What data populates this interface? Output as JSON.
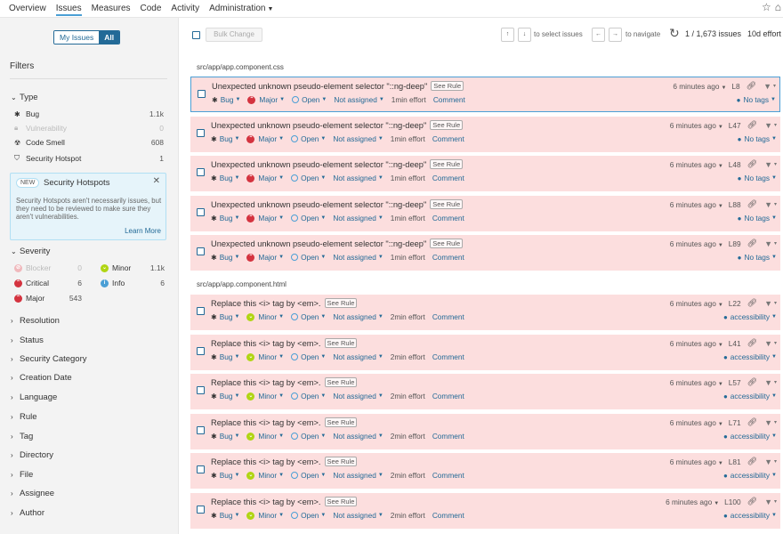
{
  "nav": {
    "items": [
      {
        "label": "Overview"
      },
      {
        "label": "Issues"
      },
      {
        "label": "Measures"
      },
      {
        "label": "Code"
      },
      {
        "label": "Activity"
      },
      {
        "label": "Administration"
      }
    ],
    "icons": [
      "star-icon",
      "home-icon"
    ]
  },
  "sidebar": {
    "toggle": {
      "my_issues": "My Issues",
      "all": "All"
    },
    "filters_title": "Filters",
    "type": {
      "label": "Type",
      "items": [
        {
          "label": "Bug",
          "count": "1.1k",
          "icon": "bug-icon"
        },
        {
          "label": "Vulnerability",
          "count": "0",
          "icon": "lock-icon"
        },
        {
          "label": "Code Smell",
          "count": "608",
          "icon": "code-smell-icon"
        },
        {
          "label": "Security Hotspot",
          "count": "1",
          "icon": "hotspot-icon"
        }
      ]
    },
    "hotspot_box": {
      "badge": "NEW",
      "title": "Security Hotspots",
      "text": "Security Hotspots aren't necessarily issues, but they need to be reviewed to make sure they aren't vulnerabilities.",
      "link": "Learn More"
    },
    "severity": {
      "label": "Severity",
      "items": [
        {
          "label": "Blocker",
          "count": "0",
          "color": "#d4333f"
        },
        {
          "label": "Minor",
          "count": "1.1k",
          "color": "#b0d513"
        },
        {
          "label": "Critical",
          "count": "6",
          "color": "#d4333f"
        },
        {
          "label": "Info",
          "count": "6",
          "color": "#4b9fd5"
        },
        {
          "label": "Major",
          "count": "543",
          "color": "#d4333f"
        }
      ]
    },
    "facets": [
      {
        "label": "Resolution"
      },
      {
        "label": "Status"
      },
      {
        "label": "Security Category"
      },
      {
        "label": "Creation Date"
      },
      {
        "label": "Language"
      },
      {
        "label": "Rule"
      },
      {
        "label": "Tag"
      },
      {
        "label": "Directory"
      },
      {
        "label": "File"
      },
      {
        "label": "Assignee"
      },
      {
        "label": "Author"
      }
    ]
  },
  "toolbar": {
    "bulk_change": "Bulk Change",
    "up_arrow": "↑",
    "down_arrow": "↓",
    "select_hint": "to select issues",
    "left_arrow": "←",
    "right_arrow": "→",
    "navigate_hint": "to navigate",
    "issue_count": "1 / 1,673 issues",
    "effort": "10d effort"
  },
  "groups": [
    {
      "file": "src/app/app.component.css",
      "issues": [
        {
          "message": "Unexpected unknown pseudo-element selector \"::ng-deep\"",
          "see_rule": "See Rule",
          "type": "Bug",
          "severity": "Major",
          "status": "Open",
          "assignee": "Not assigned",
          "effort": "1min effort",
          "comment": "Comment",
          "time": "6 minutes ago",
          "line": "L8",
          "tags": "No tags"
        },
        {
          "message": "Unexpected unknown pseudo-element selector \"::ng-deep\"",
          "see_rule": "See Rule",
          "type": "Bug",
          "severity": "Major",
          "status": "Open",
          "assignee": "Not assigned",
          "effort": "1min effort",
          "comment": "Comment",
          "time": "6 minutes ago",
          "line": "L47",
          "tags": "No tags"
        },
        {
          "message": "Unexpected unknown pseudo-element selector \"::ng-deep\"",
          "see_rule": "See Rule",
          "type": "Bug",
          "severity": "Major",
          "status": "Open",
          "assignee": "Not assigned",
          "effort": "1min effort",
          "comment": "Comment",
          "time": "6 minutes ago",
          "line": "L48",
          "tags": "No tags"
        },
        {
          "message": "Unexpected unknown pseudo-element selector \"::ng-deep\"",
          "see_rule": "See Rule",
          "type": "Bug",
          "severity": "Major",
          "status": "Open",
          "assignee": "Not assigned",
          "effort": "1min effort",
          "comment": "Comment",
          "time": "6 minutes ago",
          "line": "L88",
          "tags": "No tags"
        },
        {
          "message": "Unexpected unknown pseudo-element selector \"::ng-deep\"",
          "see_rule": "See Rule",
          "type": "Bug",
          "severity": "Major",
          "status": "Open",
          "assignee": "Not assigned",
          "effort": "1min effort",
          "comment": "Comment",
          "time": "6 minutes ago",
          "line": "L89",
          "tags": "No tags"
        }
      ]
    },
    {
      "file": "src/app/app.component.html",
      "issues": [
        {
          "message": "Replace this <i> tag by <em>.",
          "see_rule": "See Rule",
          "type": "Bug",
          "severity": "Minor",
          "status": "Open",
          "assignee": "Not assigned",
          "effort": "2min effort",
          "comment": "Comment",
          "time": "6 minutes ago",
          "line": "L22",
          "tags": "accessibility"
        },
        {
          "message": "Replace this <i> tag by <em>.",
          "see_rule": "See Rule",
          "type": "Bug",
          "severity": "Minor",
          "status": "Open",
          "assignee": "Not assigned",
          "effort": "2min effort",
          "comment": "Comment",
          "time": "6 minutes ago",
          "line": "L41",
          "tags": "accessibility"
        },
        {
          "message": "Replace this <i> tag by <em>.",
          "see_rule": "See Rule",
          "type": "Bug",
          "severity": "Minor",
          "status": "Open",
          "assignee": "Not assigned",
          "effort": "2min effort",
          "comment": "Comment",
          "time": "6 minutes ago",
          "line": "L57",
          "tags": "accessibility"
        },
        {
          "message": "Replace this <i> tag by <em>.",
          "see_rule": "See Rule",
          "type": "Bug",
          "severity": "Minor",
          "status": "Open",
          "assignee": "Not assigned",
          "effort": "2min effort",
          "comment": "Comment",
          "time": "6 minutes ago",
          "line": "L71",
          "tags": "accessibility"
        },
        {
          "message": "Replace this <i> tag by <em>.",
          "see_rule": "See Rule",
          "type": "Bug",
          "severity": "Minor",
          "status": "Open",
          "assignee": "Not assigned",
          "effort": "2min effort",
          "comment": "Comment",
          "time": "6 minutes ago",
          "line": "L81",
          "tags": "accessibility"
        },
        {
          "message": "Replace this <i> tag by <em>.",
          "see_rule": "See Rule",
          "type": "Bug",
          "severity": "Minor",
          "status": "Open",
          "assignee": "Not assigned",
          "effort": "2min effort",
          "comment": "Comment",
          "time": "6 minutes ago",
          "line": "L100",
          "tags": "accessibility"
        }
      ]
    }
  ],
  "colors": {
    "accent": "#236a97",
    "issue_bg": "#fcdede",
    "major": "#d4333f",
    "minor": "#b0d513",
    "info": "#4b9fd5"
  }
}
